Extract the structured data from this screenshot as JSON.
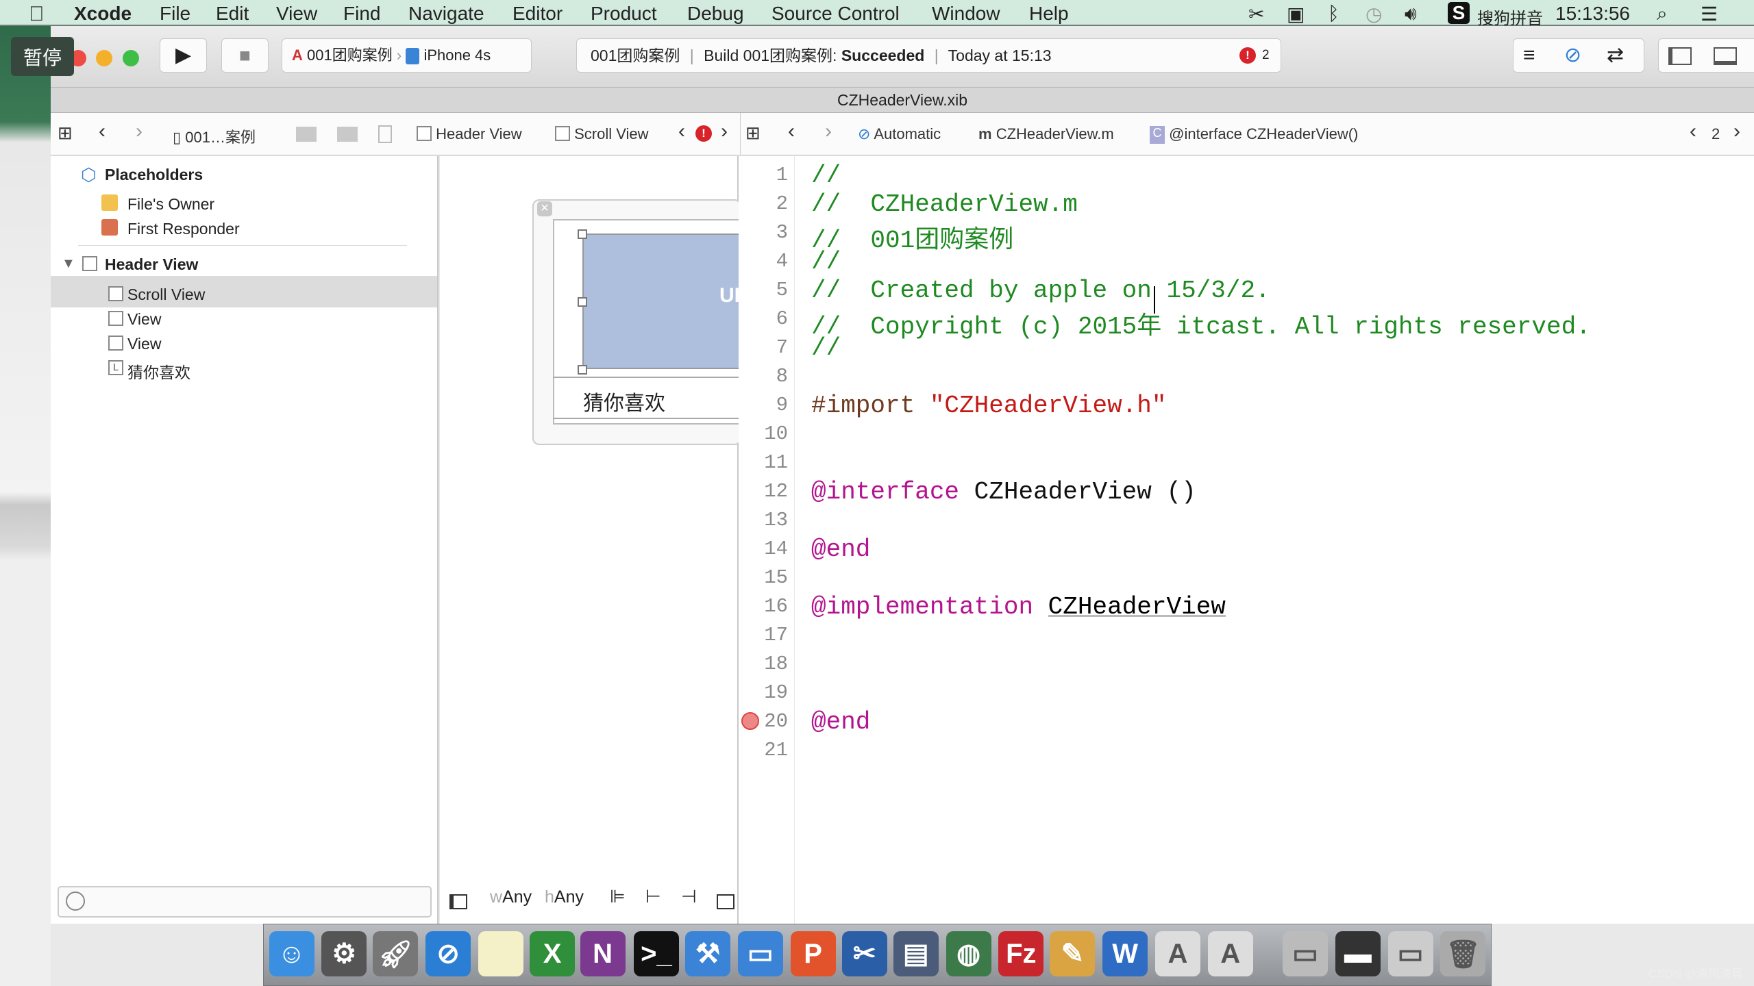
{
  "menubar": {
    "apple_icon": "apple-logo",
    "items": [
      "Xcode",
      "File",
      "Edit",
      "View",
      "Find",
      "Navigate",
      "Editor",
      "Product",
      "Debug",
      "Source Control",
      "Window",
      "Help"
    ],
    "status_icons": [
      "scissors-icon",
      "camera-icon",
      "bluetooth-icon",
      "time-machine-icon",
      "volume-icon",
      "sogou-icon"
    ],
    "input_method": "搜狗拼音",
    "clock": "15:13:56"
  },
  "overlay": {
    "pause_label": "暂停"
  },
  "toolbar": {
    "scheme": "001团购案例",
    "device": "iPhone 4s",
    "activity": {
      "project": "001团购案例",
      "build_prefix": "Build 001团购案例:",
      "build_status": "Succeeded",
      "time": "Today at 15:13",
      "error_count": "2"
    }
  },
  "tab": {
    "title": "CZHeaderView.xib"
  },
  "jumpbar_left": {
    "project": "001…案例",
    "items": [
      "Header View",
      "Scroll View"
    ]
  },
  "jumpbar_right": {
    "mode": "Automatic",
    "file": "CZHeaderView.m",
    "symbol": "@interface CZHeaderView()",
    "counter": "2"
  },
  "navigator": {
    "placeholders_title": "Placeholders",
    "placeholders": [
      "File's Owner",
      "First Responder"
    ],
    "header_view": "Header View",
    "children": [
      "Scroll View",
      "View",
      "View",
      "猜你喜欢"
    ],
    "selected": "Scroll View"
  },
  "canvas": {
    "scroll_label": "UI",
    "label_text": "猜你喜欢",
    "size_w": "Any",
    "size_h": "Any",
    "w_prefix": "w",
    "h_prefix": "h"
  },
  "code": {
    "lines": [
      [
        [
          "comment",
          "//"
        ]
      ],
      [
        [
          "comment",
          "//  CZHeaderView.m"
        ]
      ],
      [
        [
          "comment",
          "//  001团购案例"
        ]
      ],
      [
        [
          "comment",
          "//"
        ]
      ],
      [
        [
          "comment",
          "//  Created by apple on 15/3/2."
        ]
      ],
      [
        [
          "comment",
          "//  Copyright (c) 2015年 itcast. All rights reserved."
        ]
      ],
      [
        [
          "comment",
          "//"
        ]
      ],
      [],
      [
        [
          "pre",
          "#import "
        ],
        [
          "str",
          "\"CZHeaderView.h\""
        ]
      ],
      [],
      [],
      [
        [
          "kw",
          "@interface"
        ],
        [
          "plain",
          " CZHeaderView ()"
        ]
      ],
      [],
      [
        [
          "kw",
          "@end"
        ]
      ],
      [],
      [
        [
          "kw",
          "@implementation"
        ],
        [
          "plain",
          " "
        ],
        [
          "ul",
          "CZHeaderView"
        ]
      ],
      [],
      [],
      [],
      [
        [
          "kw",
          "@end"
        ]
      ],
      []
    ],
    "error_line": 20
  },
  "dock": {
    "apps": [
      "Finder",
      "System Preferences",
      "Launchpad",
      "Safari",
      "Notes",
      "Excel",
      "OneNote",
      "Terminal",
      "Xcode",
      "Simulator",
      "PowerPoint",
      "Snip",
      "Photo Slideshow",
      "Network",
      "FileZilla",
      "Pages",
      "Word",
      "Preview",
      "Preview",
      "Downloads",
      "Display",
      "Folder",
      "Trash"
    ]
  },
  "watermark": "CSDN @清风清晨"
}
